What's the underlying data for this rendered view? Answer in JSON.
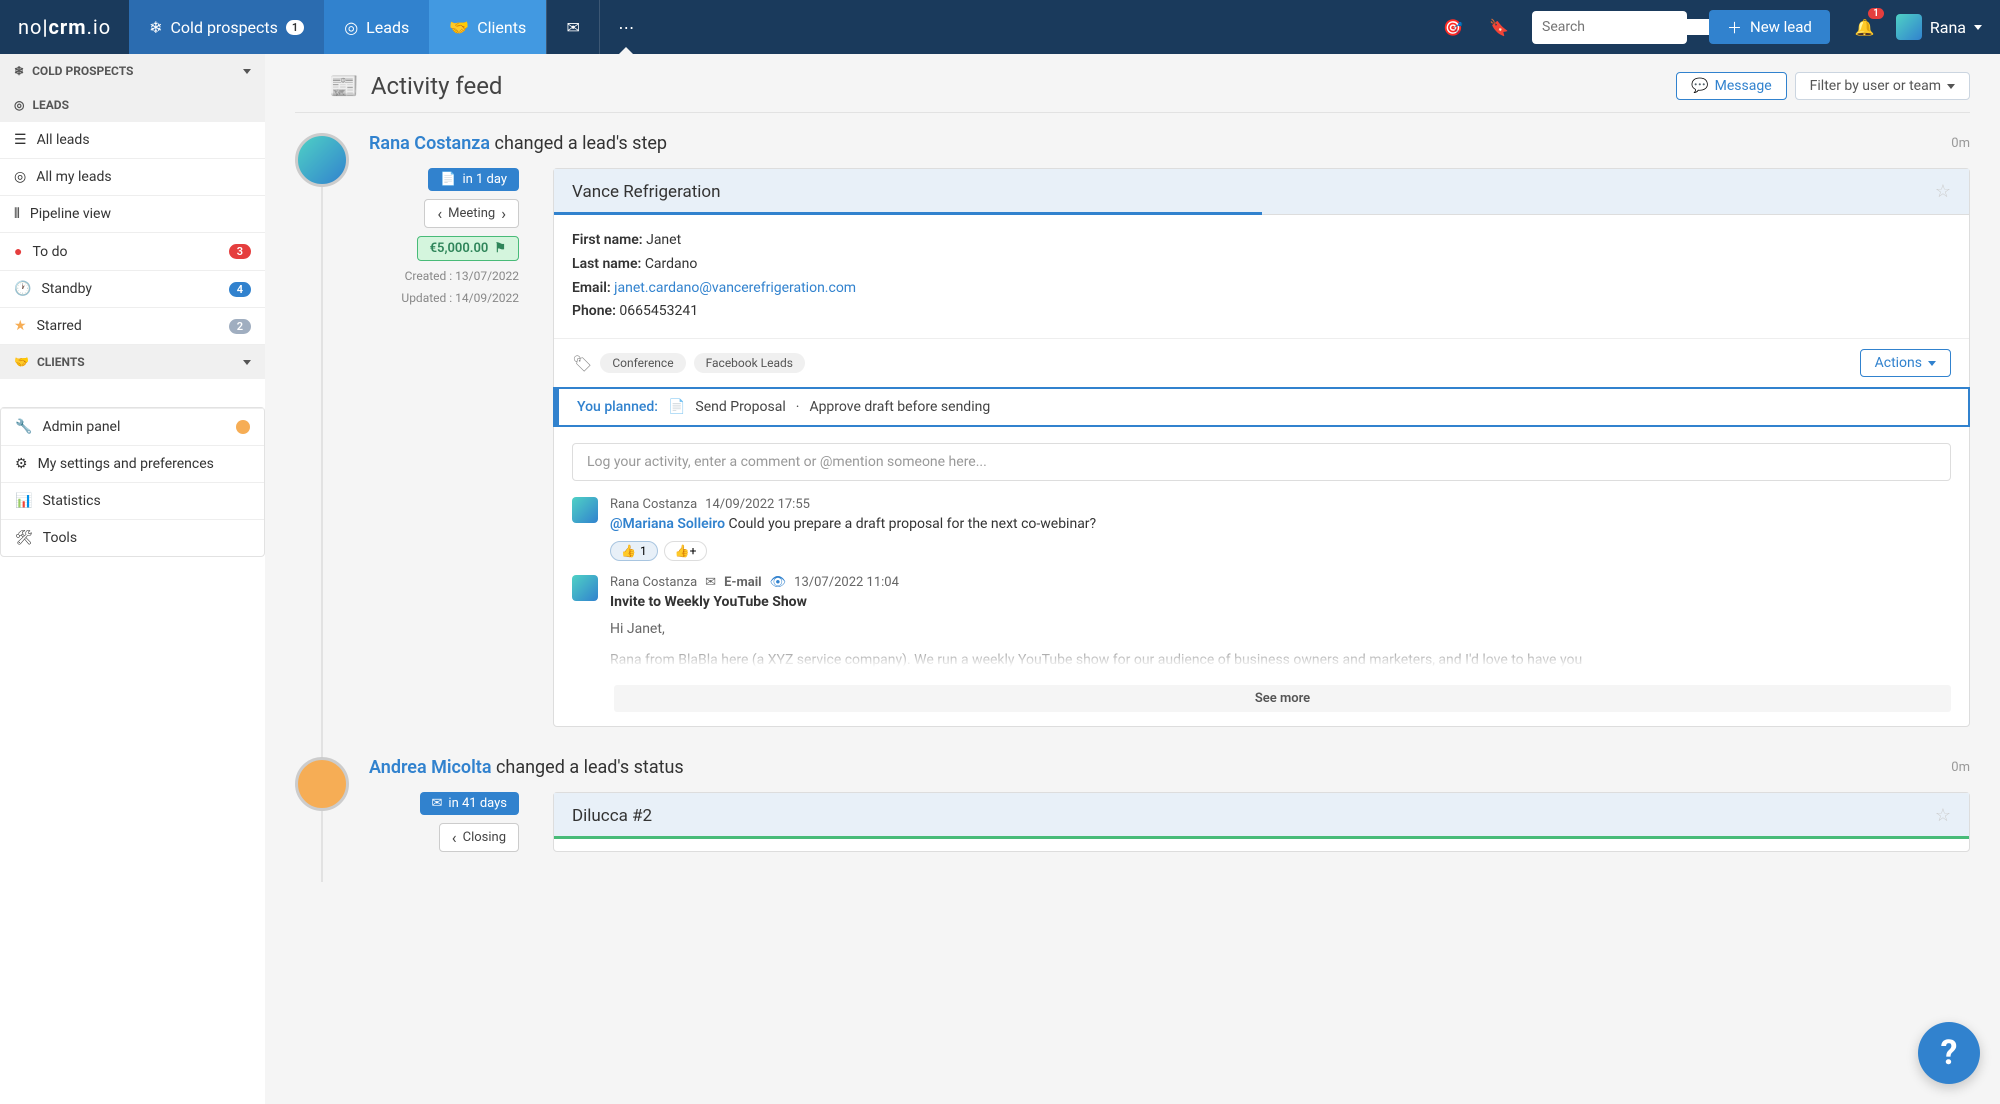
{
  "logo": "no|crm.io",
  "nav": {
    "prospects": "Cold prospects",
    "prospects_badge": "1",
    "leads": "Leads",
    "clients": "Clients"
  },
  "search": {
    "placeholder": "Search"
  },
  "new_lead": "New lead",
  "notif_badge": "1",
  "user_name": "Rana",
  "sidebar": {
    "cold_prospects_hdr": "COLD PROSPECTS",
    "leads_hdr": "LEADS",
    "all_leads": "All leads",
    "all_my_leads": "All my leads",
    "pipeline_view": "Pipeline view",
    "to_do": "To do",
    "to_do_badge": "3",
    "standby": "Standby",
    "standby_badge": "4",
    "starred": "Starred",
    "starred_badge": "2",
    "clients_hdr": "CLIENTS",
    "admin_panel": "Admin panel",
    "my_settings": "My settings and preferences",
    "statistics": "Statistics",
    "tools": "Tools"
  },
  "page_title": "Activity feed",
  "message_btn": "Message",
  "filter_btn": "Filter by user or team",
  "feed1": {
    "user": "Rana Costanza",
    "action": " changed a lead's step",
    "time": "0m",
    "due_pill": "in 1 day",
    "step_pill": "Meeting",
    "amount": "€5,000.00",
    "created": "Created : 13/07/2022",
    "updated": "Updated : 14/09/2022",
    "lead_name": "Vance Refrigeration",
    "first_name_label": "First name:",
    "first_name": "Janet",
    "last_name_label": "Last name:",
    "last_name": "Cardano",
    "email_label": "Email:",
    "email": "janet.cardano@vancerefrigeration.com",
    "phone_label": "Phone:",
    "phone": "0665453241",
    "tag1": "Conference",
    "tag2": "Facebook Leads",
    "actions_btn": "Actions",
    "planned_label": "You planned:",
    "planned_task1": "Send Proposal",
    "planned_task2": "Approve draft before sending",
    "comment_placeholder": "Log your activity, enter a comment or @mention someone here...",
    "c1_user": "Rana Costanza",
    "c1_time": "14/09/2022 17:55",
    "c1_mention": "@Mariana Solleiro",
    "c1_text": " Could you prepare a draft proposal for the next co-webinar?",
    "reaction_count": "1",
    "c2_user": "Rana Costanza",
    "c2_channel": "E-mail",
    "c2_time": "13/07/2022 11:04",
    "c2_subject": "Invite to Weekly YouTube Show",
    "c2_greeting": "Hi Janet,",
    "c2_body": "Rana from BlaBla here (a XYZ service company). We run a weekly YouTube show for our audience of business owners and marketers, and I'd love to have you",
    "see_more": "See more"
  },
  "feed2": {
    "user": "Andrea Micolta",
    "action": " changed a lead's status",
    "time": "0m",
    "due_pill": "in 41 days",
    "step_pill": "Closing",
    "lead_name": "Dilucca #2"
  }
}
